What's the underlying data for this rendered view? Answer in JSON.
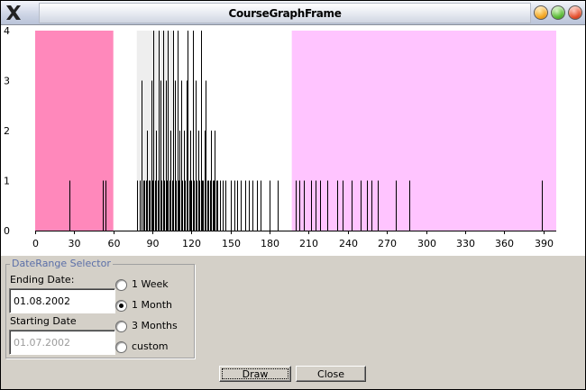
{
  "window": {
    "title": "CourseGraphFrame",
    "icons": [
      "x-logo-icon",
      "minimize-icon",
      "maximize-icon",
      "close-icon"
    ],
    "colors": {
      "minimize": "#f2a31c",
      "maximize": "#55b830",
      "close": "#e34b28"
    }
  },
  "chart_data": {
    "type": "bar",
    "xlim": [
      0,
      400
    ],
    "ylim": [
      0,
      4
    ],
    "x_ticks": [
      "0",
      "30",
      "60",
      "90",
      "120",
      "150",
      "180",
      "210",
      "240",
      "270",
      "300",
      "330",
      "360",
      "390"
    ],
    "y_ticks": [
      "0",
      "1",
      "2",
      "3",
      "4"
    ],
    "regions": [
      {
        "from": 0,
        "to": 60,
        "color": "#ff88bb"
      },
      {
        "from": 78,
        "to": 106,
        "color": "#eeeeee"
      },
      {
        "from": 197,
        "to": 400,
        "color": "#ffc4ff"
      }
    ],
    "bars": [
      [
        26,
        1
      ],
      [
        52,
        1
      ],
      [
        54,
        1
      ],
      [
        78,
        1
      ],
      [
        80,
        1
      ],
      [
        82,
        3
      ],
      [
        83,
        1
      ],
      [
        84,
        1
      ],
      [
        85,
        1
      ],
      [
        86,
        2
      ],
      [
        87,
        1
      ],
      [
        88,
        1
      ],
      [
        89,
        3
      ],
      [
        90,
        1
      ],
      [
        91,
        4
      ],
      [
        92,
        1
      ],
      [
        93,
        2
      ],
      [
        94,
        1
      ],
      [
        95,
        4
      ],
      [
        96,
        3
      ],
      [
        97,
        1
      ],
      [
        98,
        4
      ],
      [
        99,
        1
      ],
      [
        100,
        3
      ],
      [
        101,
        1
      ],
      [
        102,
        4
      ],
      [
        103,
        1
      ],
      [
        104,
        2
      ],
      [
        105,
        1
      ],
      [
        106,
        4
      ],
      [
        107,
        3
      ],
      [
        108,
        1
      ],
      [
        109,
        4
      ],
      [
        110,
        1
      ],
      [
        111,
        2
      ],
      [
        112,
        3
      ],
      [
        113,
        1
      ],
      [
        114,
        2
      ],
      [
        115,
        1
      ],
      [
        116,
        3
      ],
      [
        117,
        4
      ],
      [
        118,
        1
      ],
      [
        119,
        2
      ],
      [
        120,
        1
      ],
      [
        121,
        4
      ],
      [
        122,
        1
      ],
      [
        123,
        3
      ],
      [
        124,
        1
      ],
      [
        125,
        2
      ],
      [
        126,
        1
      ],
      [
        127,
        4
      ],
      [
        128,
        1
      ],
      [
        129,
        1
      ],
      [
        130,
        2
      ],
      [
        131,
        3
      ],
      [
        132,
        1
      ],
      [
        133,
        1
      ],
      [
        134,
        1
      ],
      [
        135,
        2
      ],
      [
        136,
        1
      ],
      [
        137,
        1
      ],
      [
        138,
        2
      ],
      [
        139,
        1
      ],
      [
        140,
        1
      ],
      [
        142,
        1
      ],
      [
        144,
        1
      ],
      [
        146,
        1
      ],
      [
        150,
        1
      ],
      [
        153,
        1
      ],
      [
        155,
        1
      ],
      [
        158,
        1
      ],
      [
        161,
        1
      ],
      [
        164,
        1
      ],
      [
        167,
        1
      ],
      [
        170,
        1
      ],
      [
        173,
        1
      ],
      [
        180,
        1
      ],
      [
        186,
        1
      ],
      [
        200,
        1
      ],
      [
        203,
        1
      ],
      [
        206,
        1
      ],
      [
        212,
        1
      ],
      [
        215,
        1
      ],
      [
        219,
        1
      ],
      [
        224,
        1
      ],
      [
        232,
        1
      ],
      [
        236,
        1
      ],
      [
        243,
        1
      ],
      [
        250,
        1
      ],
      [
        255,
        1
      ],
      [
        258,
        1
      ],
      [
        263,
        1
      ],
      [
        277,
        1
      ],
      [
        287,
        1
      ],
      [
        389,
        1
      ]
    ]
  },
  "date_range": {
    "legend": "DateRange Selector",
    "ending_label": "Ending Date:",
    "ending_value": "01.08.2002",
    "starting_label": "Starting Date",
    "starting_value": "01.07.2002",
    "options": [
      {
        "label": "1 Week",
        "checked": false
      },
      {
        "label": "1 Month",
        "checked": true
      },
      {
        "label": "3 Months",
        "checked": false
      },
      {
        "label": "custom",
        "checked": false
      }
    ]
  },
  "buttons": {
    "draw": "Draw",
    "close": "Close"
  }
}
